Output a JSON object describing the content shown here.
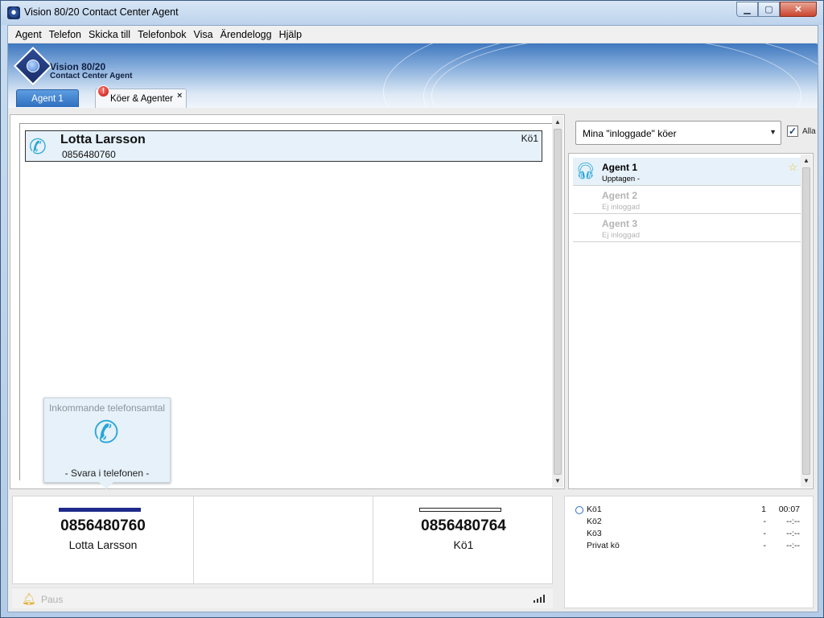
{
  "window": {
    "title": "Vision 80/20 Contact Center Agent"
  },
  "menu": {
    "items": [
      "Agent",
      "Telefon",
      "Skicka till",
      "Telefonbok",
      "Visa",
      "Ärendelogg",
      "Hjälp"
    ]
  },
  "brand": {
    "line1": "Vision 80/20",
    "line2": "Contact Center Agent"
  },
  "tabs": {
    "agent": "Agent 1",
    "queues": "Köer & Agenter",
    "queues_alert": "!",
    "close": "×"
  },
  "call_list": [
    {
      "name": "Lotta Larsson",
      "number": "0856480760",
      "queue": "Kö1"
    }
  ],
  "incoming": {
    "title": "Inkommande telefonsamtal",
    "action": "- Svara i telefonen -"
  },
  "slots": [
    {
      "number": "0856480760",
      "sub": "Lotta Larsson",
      "active": true
    },
    {
      "number": "",
      "sub": "",
      "active": false
    },
    {
      "number": "0856480764",
      "sub": "Kö1",
      "active": false
    }
  ],
  "status": {
    "pause": "Paus"
  },
  "queue_filter": {
    "selected": "Mina \"inloggade\" köer",
    "all_label": "Alla",
    "all_checked": true
  },
  "agents": [
    {
      "name": "Agent 1",
      "status": "Upptagen -",
      "logged_in": true,
      "favorite": true
    },
    {
      "name": "Agent 2",
      "status": "Ej inloggad",
      "logged_in": false,
      "favorite": false
    },
    {
      "name": "Agent 3",
      "status": "Ej inloggad",
      "logged_in": false,
      "favorite": false
    }
  ],
  "queue_summary": [
    {
      "name": "Kö1",
      "count": "1",
      "time": "00:07",
      "selected": true
    },
    {
      "name": "Kö2",
      "count": "-",
      "time": "--:--",
      "selected": false
    },
    {
      "name": "Kö3",
      "count": "-",
      "time": "--:--",
      "selected": false
    },
    {
      "name": "Privat kö",
      "count": "-",
      "time": "--:--",
      "selected": false
    }
  ],
  "colors": {
    "accent": "#27a6d8",
    "active_slot": "#1f2a8a",
    "tab_blue": "#2f6fbe"
  },
  "icons": {
    "phone": "phone-icon",
    "headset": "headset-icon",
    "star": "star-icon",
    "bell": "bell-icon",
    "signal": "signal-icon"
  }
}
